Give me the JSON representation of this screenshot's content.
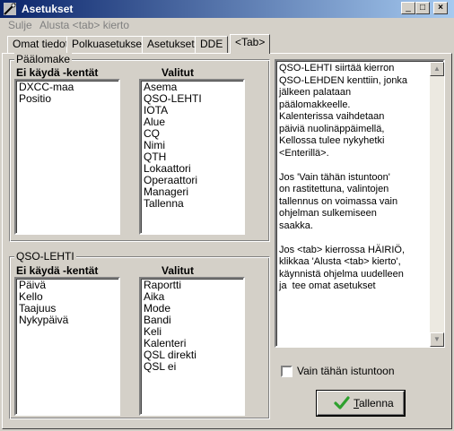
{
  "window": {
    "title": "Asetukset",
    "minimize": "_",
    "maximize": "□",
    "close": "×"
  },
  "menu": {
    "items": [
      "Sulje",
      "Alusta <tab> kierto"
    ]
  },
  "tabs": [
    "Omat tiedot",
    "Polkuasetukset",
    "Asetukset",
    "DDE",
    "<Tab>"
  ],
  "active_tab": 4,
  "paalomake": {
    "legend": "Päälomake",
    "left_header": "Ei käydä -kentät",
    "right_header": "Valitut",
    "left_items": [
      "DXCC-maa",
      "Positio"
    ],
    "right_items": [
      "Asema",
      "QSO-LEHTI",
      "IOTA",
      "Alue",
      "CQ",
      "Nimi",
      "QTH",
      "Lokaattori",
      "Operaattori",
      "Manageri",
      "Tallenna"
    ]
  },
  "qso_lehti": {
    "legend": "QSO-LEHTI",
    "left_header": "Ei käydä -kentät",
    "right_header": "Valitut",
    "left_items": [
      "Päivä",
      "Kello",
      "Taajuus",
      "Nykypäivä"
    ],
    "right_items": [
      "Raportti",
      "Aika",
      "Mode",
      "Bandi",
      "Keli",
      "Kalenteri",
      "QSL direkti",
      "QSL ei"
    ]
  },
  "help_text": "QSO-LEHTI siirtää kierron\nQSO-LEHDEN kenttiin, jonka\njälkeen palataan\npäälomakkeelle.\nKalenterissa vaihdetaan\npäiviä nuolinäppäimellä,\nKellossa tulee nykyhetki\n<Enterillä>.\n\nJos 'Vain tähän istuntoon'\non rastitettuna, valintojen\ntallennus on voimassa vain\nohjelman sulkemiseen\nsaakka.\n\nJos <tab> kierrossa HÄIRIÖ,\nklikkaa 'Alusta <tab> kierto',\nkäynnistä ohjelma uudelleen\nja  tee omat asetukset",
  "checkbox": {
    "label": "Vain tähän istuntoon",
    "checked": false
  },
  "save_button": {
    "mnemonic": "T",
    "rest": "allenna"
  },
  "colors": {
    "titlebar_start": "#0a246a",
    "titlebar_end": "#a6caf0",
    "face": "#d4d0c8",
    "check_green": "#2ea02e"
  }
}
